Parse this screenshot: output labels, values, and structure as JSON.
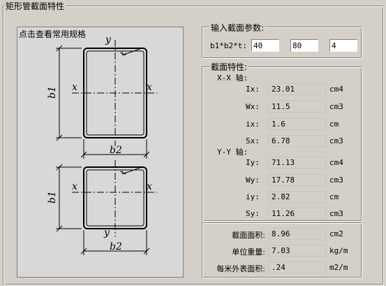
{
  "window_title": "矩形管截面特性",
  "diagram": {
    "link_label": "点击查看常用规格",
    "labels": {
      "y_top": "y",
      "y_bottom": "y",
      "x": "x",
      "t": "t",
      "b1": "b1",
      "b2": "b2"
    }
  },
  "input_group": {
    "title": "输入截面参数:",
    "param_label": "b1*b2*t:",
    "b1": "40",
    "b2": "80",
    "t": "4"
  },
  "props_group": {
    "title": "截面特性:",
    "xx_title": "X-X 轴:",
    "yy_title": "Y-Y 轴:",
    "xx": [
      {
        "name": "Ix:",
        "value": "23.01",
        "unit": "cm4"
      },
      {
        "name": "Wx:",
        "value": "11.5",
        "unit": "cm3"
      },
      {
        "name": "ix:",
        "value": "1.6",
        "unit": "cm"
      },
      {
        "name": "Sx:",
        "value": "6.78",
        "unit": "cm3"
      }
    ],
    "yy": [
      {
        "name": "Iy:",
        "value": "71.13",
        "unit": "cm4"
      },
      {
        "name": "Wy:",
        "value": "17.78",
        "unit": "cm3"
      },
      {
        "name": "iy:",
        "value": "2.82",
        "unit": "cm"
      },
      {
        "name": "Sy:",
        "value": "11.26",
        "unit": "cm3"
      }
    ]
  },
  "summary": [
    {
      "name": "截面面积:",
      "value": "8.96",
      "unit": "cm2"
    },
    {
      "name": "单位重量:",
      "value": "7.03",
      "unit": "kg/m"
    },
    {
      "name": "每米外表面积:",
      "value": ".24",
      "unit": "m2/m"
    }
  ]
}
